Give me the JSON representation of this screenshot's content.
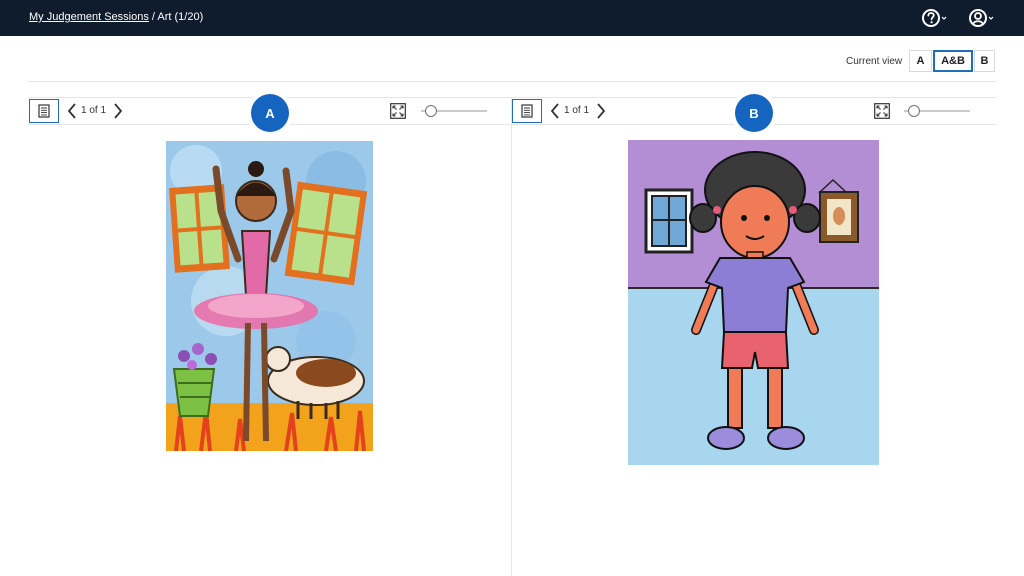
{
  "header": {
    "breadcrumb_link": "My Judgement Sessions",
    "breadcrumb_rest": " / Art (1/20)",
    "help_icon": "help-circle-icon",
    "user_icon": "user-circle-icon"
  },
  "view_switch": {
    "label": "Current view",
    "options": [
      "A",
      "A&B",
      "B"
    ],
    "selected": "A&B"
  },
  "panes": [
    {
      "badge": "A",
      "page_text": "1 of 1",
      "zoom_level": 0,
      "image_description": "child painting of a ballerina in a pink tutu with windows, flowers and a dog"
    },
    {
      "badge": "B",
      "page_text": "1 of 1",
      "zoom_level": 0,
      "image_description": "child drawing of a girl with pigtails in a purple shirt and red shorts"
    }
  ],
  "colors": {
    "topbar": "#0f1c2e",
    "accent": "#1565c0",
    "active_border": "#1f6fb7"
  }
}
